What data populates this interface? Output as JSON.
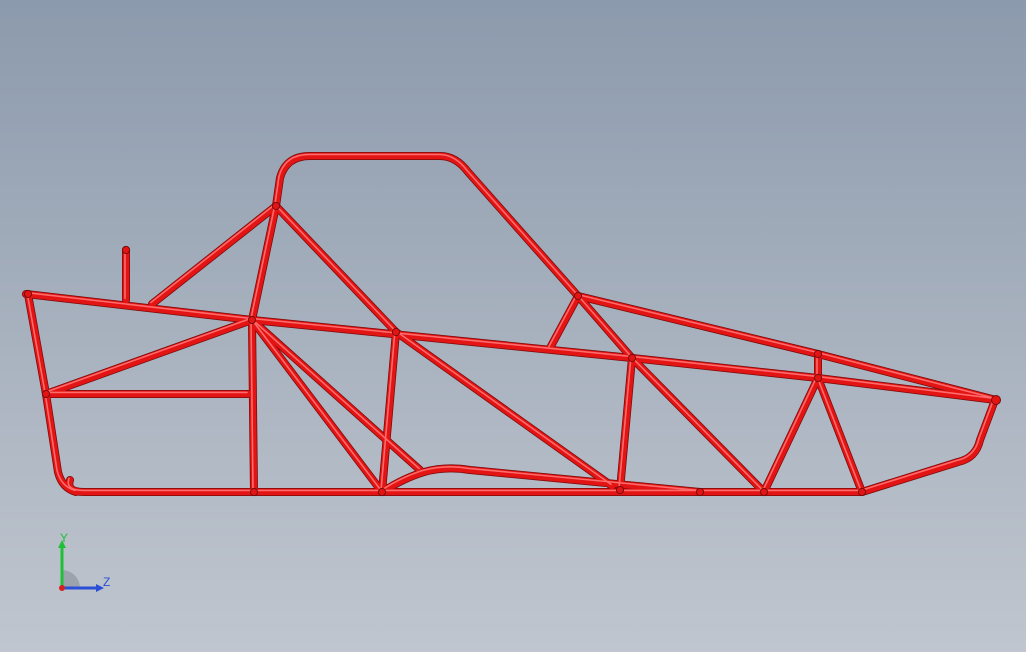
{
  "viewport": {
    "background_top": "#8c9aad",
    "background_bottom": "#c0c6cf"
  },
  "model": {
    "name": "roll-cage-frame",
    "tube_color": "#e21414",
    "tube_shadow_color": "#7a0a0a",
    "tube_highlight_color": "#ff6a6a"
  },
  "triad": {
    "y_label": "Y",
    "z_label": "Z",
    "y_color": "#1fbf3a",
    "z_color": "#2b4fd6",
    "x_color": "#d62020"
  }
}
